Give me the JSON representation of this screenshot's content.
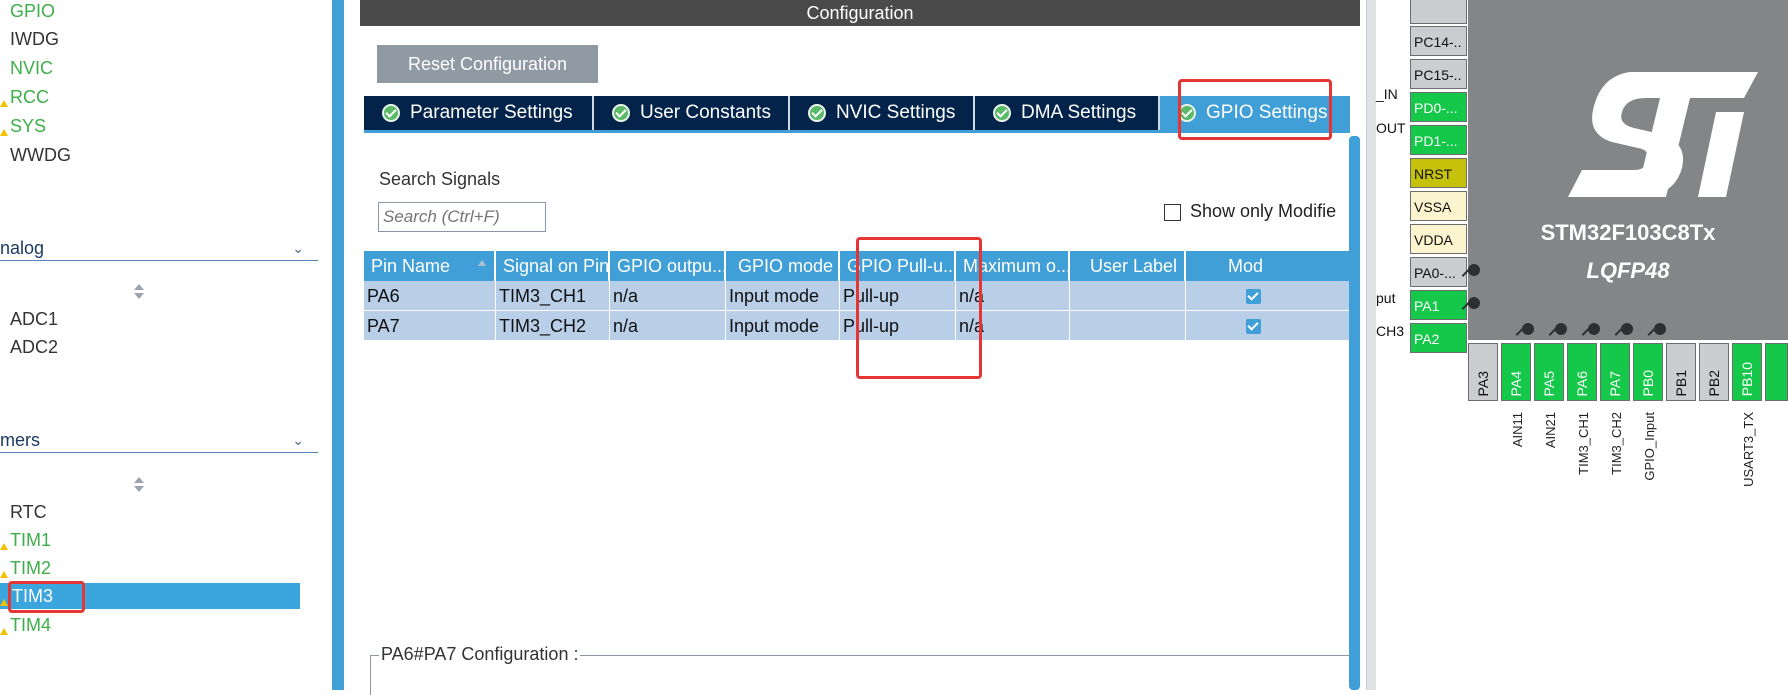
{
  "left_panel": {
    "top_items": [
      {
        "label": "GPIO",
        "color": "green",
        "warn": false
      },
      {
        "label": "IWDG",
        "color": "black",
        "warn": false
      },
      {
        "label": "NVIC",
        "color": "green",
        "warn": false
      },
      {
        "label": "RCC",
        "color": "green",
        "warn": true
      },
      {
        "label": "SYS",
        "color": "green",
        "warn": true
      },
      {
        "label": "WWDG",
        "color": "black",
        "warn": false
      }
    ],
    "analog_header": "nalog",
    "analog_items": [
      "ADC1",
      "ADC2"
    ],
    "timers_header": "mers",
    "timer_items": [
      "RTC",
      "TIM1",
      "TIM2",
      "TIM3",
      "TIM4"
    ]
  },
  "config": {
    "title": "Configuration",
    "reset_button": "Reset Configuration",
    "tabs": [
      "Parameter Settings",
      "User Constants",
      "NVIC Settings",
      "DMA Settings",
      "GPIO Settings"
    ],
    "active_tab": "GPIO Settings",
    "search_label": "Search Signals",
    "search_placeholder": "Search (Ctrl+F)",
    "show_only_label": "Show only Modifie",
    "table": {
      "headers": [
        "Pin Name",
        "Signal on Pin",
        "GPIO outpu...",
        "GPIO mode",
        "GPIO Pull-u...",
        "Maximum o...",
        "User Label",
        "Mod"
      ],
      "rows": [
        [
          "PA6",
          "TIM3_CH1",
          "n/a",
          "Input mode",
          "Pull-up",
          "n/a",
          "",
          ""
        ],
        [
          "PA7",
          "TIM3_CH2",
          "n/a",
          "Input mode",
          "Pull-up",
          "n/a",
          "",
          ""
        ]
      ]
    },
    "pin_config_label": "PA6#PA7 Configuration :"
  },
  "chip": {
    "name": "STM32F103C8Tx",
    "package": "LQFP48",
    "left_pins": [
      {
        "label": "",
        "style": "gray"
      },
      {
        "label": "PC14-..",
        "style": "gray"
      },
      {
        "label": "PC15-..",
        "style": "gray"
      },
      {
        "label": "PD0-...",
        "style": "green"
      },
      {
        "label": "PD1-...",
        "style": "green"
      },
      {
        "label": "NRST",
        "style": "olive"
      },
      {
        "label": "VSSA",
        "style": "beige"
      },
      {
        "label": "VDDA",
        "style": "beige"
      },
      {
        "label": "PA0-...",
        "style": "gray"
      },
      {
        "label": "PA1",
        "style": "green"
      },
      {
        "label": "PA2",
        "style": "green"
      }
    ],
    "left_external_labels": [
      "_IN",
      "OUT",
      "put",
      "CH3"
    ],
    "bottom_pins": [
      {
        "label": "PA3",
        "style": "gray"
      },
      {
        "label": "PA4",
        "style": "green"
      },
      {
        "label": "PA5",
        "style": "green"
      },
      {
        "label": "PA6",
        "style": "green"
      },
      {
        "label": "PA7",
        "style": "green"
      },
      {
        "label": "PB0",
        "style": "green"
      },
      {
        "label": "PB1",
        "style": "gray"
      },
      {
        "label": "PB2",
        "style": "gray"
      },
      {
        "label": "PB10",
        "style": "green"
      },
      {
        "label": "",
        "style": "green"
      }
    ],
    "bottom_signal_labels": [
      "",
      "AIN11",
      "AIN21",
      "TIM3_CH1",
      "TIM3_CH2",
      "GPIO_Input",
      "",
      "",
      "USART3_TX",
      ""
    ]
  },
  "colors": {
    "accent": "#3f9fd6",
    "tab_bar": "#03234b",
    "row_bg": "#b9cfe8",
    "pin_green": "#15c84a",
    "highlight": "#e53535",
    "chip_body": "#838587"
  }
}
